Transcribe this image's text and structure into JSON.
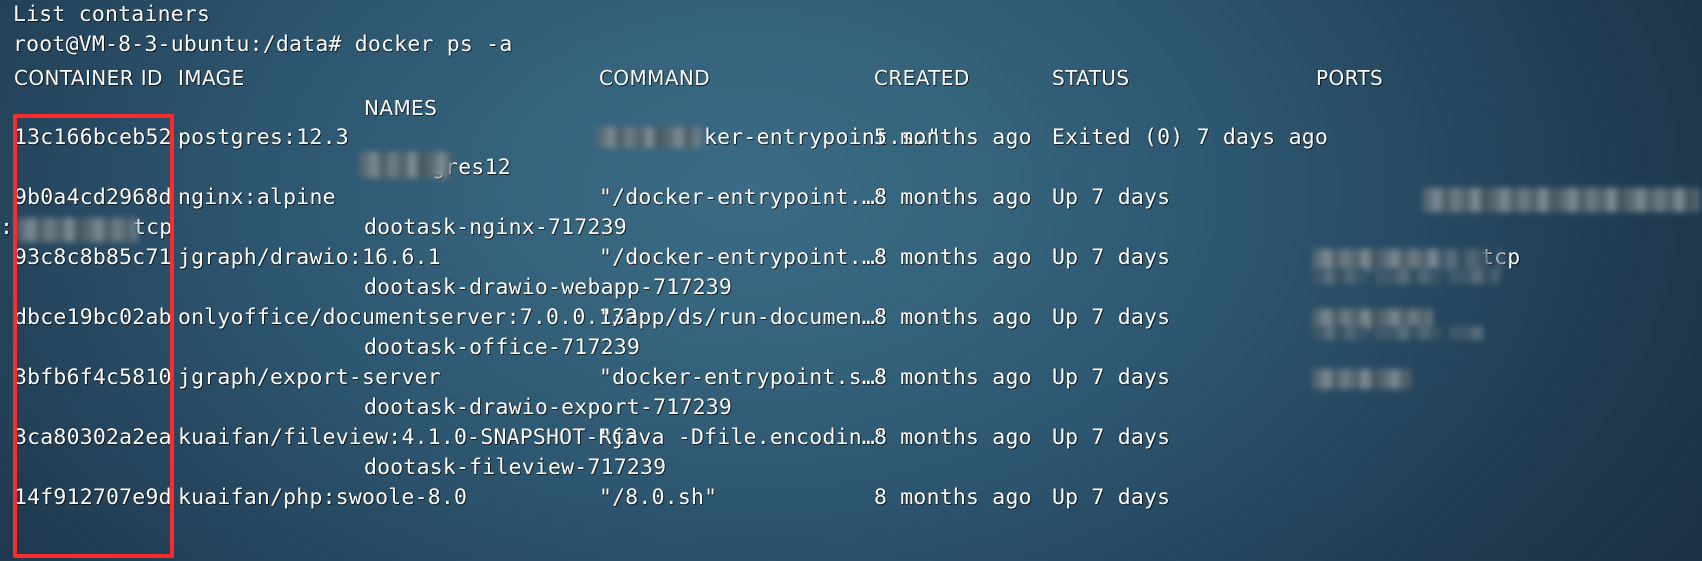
{
  "colors": {
    "terminal_bg_center": "#3a6b86",
    "terminal_bg_edge": "#1a3146",
    "text": "#ffffff",
    "annotation_rect": "#fb2b2b"
  },
  "title": "List containers",
  "prompt": {
    "text": "root@VM-8-3-ubuntu:/data# docker ps -a",
    "user_host": "root@VM-8-3-ubuntu",
    "cwd": "/data",
    "symbol": "#",
    "command": "docker ps -a"
  },
  "table": {
    "headers": {
      "container_id": "CONTAINER ID",
      "image": "IMAGE",
      "names": "NAMES",
      "command": "COMMAND",
      "created": "CREATED",
      "status": "STATUS",
      "ports": "PORTS"
    },
    "rows": [
      {
        "container_id": "13c166bceb52",
        "image": "postgres:12.3",
        "names": "gres12",
        "names_redacted": true,
        "command": "ker-entrypoint.s…\"",
        "command_redacted": true,
        "created": "5 months ago",
        "status": "Exited (0) 7 days ago",
        "ports": "",
        "ports_redacted": false
      },
      {
        "container_id": "9b0a4cd2968d",
        "image": "nginx:alpine",
        "names": "dootask-nginx-717239",
        "names_redacted": false,
        "command": "\"/docker-entrypoint.…\"",
        "command_redacted": false,
        "created": "8 months ago",
        "status": "Up 7 days",
        "ports": "tcp",
        "ports_redacted": true
      },
      {
        "container_id": "93c8c8b85c71",
        "image": "jgraph/drawio:16.6.1",
        "names": "dootask-drawio-webapp-717239",
        "names_redacted": false,
        "command": "\"/docker-entrypoint.…\"",
        "command_redacted": false,
        "created": "8 months ago",
        "status": "Up 7 days",
        "ports": "tcp",
        "ports_redacted": true
      },
      {
        "container_id": "dbce19bc02ab",
        "image": "onlyoffice/documentserver:7.0.0.132",
        "names": "dootask-office-717239",
        "names_redacted": false,
        "command": "\"/app/ds/run-documen…\"",
        "command_redacted": false,
        "created": "8 months ago",
        "status": "Up 7 days",
        "ports": "",
        "ports_redacted": true
      },
      {
        "container_id": "3bfb6f4c5810",
        "image": "jgraph/export-server",
        "names": "dootask-drawio-export-717239",
        "names_redacted": false,
        "command": "\"docker-entrypoint.s…\"",
        "command_redacted": false,
        "created": "8 months ago",
        "status": "Up 7 days",
        "ports": "",
        "ports_redacted": true
      },
      {
        "container_id": "3ca80302a2ea",
        "image": "kuaifan/fileview:4.1.0-SNAPSHOT-RC3",
        "names": "dootask-fileview-717239",
        "names_redacted": false,
        "command": "\"java -Dfile.encodin…\"",
        "command_redacted": false,
        "created": "8 months ago",
        "status": "Up 7 days",
        "ports": "",
        "ports_redacted": false
      },
      {
        "container_id": "14f912707e9d",
        "image": "kuaifan/php:swoole-8.0",
        "names": "",
        "names_redacted": false,
        "command": "\"/8.0.sh\"",
        "command_redacted": false,
        "created": "8 months ago",
        "status": "Up 7 days",
        "ports": "",
        "ports_redacted": false
      }
    ]
  },
  "annotation": {
    "shape": "rectangle",
    "target_column": "CONTAINER ID",
    "color": "#fb2b2b"
  }
}
